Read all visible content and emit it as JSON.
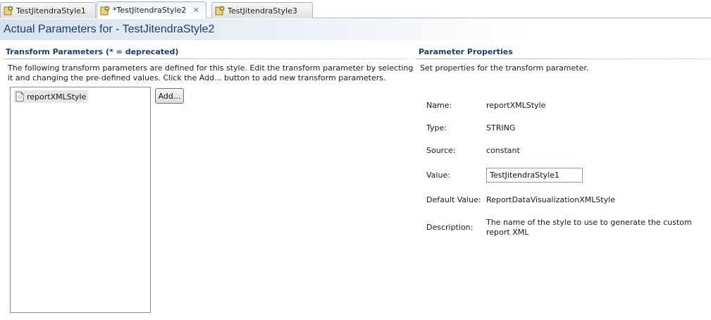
{
  "tabs": [
    {
      "label": "TestJitendraStyle1",
      "active": false
    },
    {
      "label": "*TestJitendraStyle2",
      "active": true
    },
    {
      "label": "TestJitendraStyle3",
      "active": false
    }
  ],
  "header": {
    "title": "Actual Parameters for - TestJitendraStyle2"
  },
  "transform_params": {
    "title": "Transform Parameters (* = deprecated)",
    "desc_line1": "The following transform parameters are defined for this style. Edit the transform parameter by selecting",
    "desc_line2": "it and changing the pre-defined values. Click the Add... button to add new transform parameters.",
    "items": [
      "reportXMLStyle"
    ],
    "add_label": "Add..."
  },
  "properties": {
    "title": "Parameter Properties",
    "desc": "Set properties for the transform parameter.",
    "name_label": "Name:",
    "name_value": "reportXMLStyle",
    "type_label": "Type:",
    "type_value": "STRING",
    "source_label": "Source:",
    "source_value": "constant",
    "value_label": "Value:",
    "value_value": "TestJitendraStyle1",
    "default_label": "Default Value:",
    "default_value": "ReportDataVisualizationXMLStyle",
    "description_label": "Description:",
    "description_line1": "The name of the style to use to generate the custom",
    "description_line2": "report XML"
  },
  "colors": {
    "title_blue": "#1c3e6e",
    "header_gradient": "#d6e2f0"
  }
}
